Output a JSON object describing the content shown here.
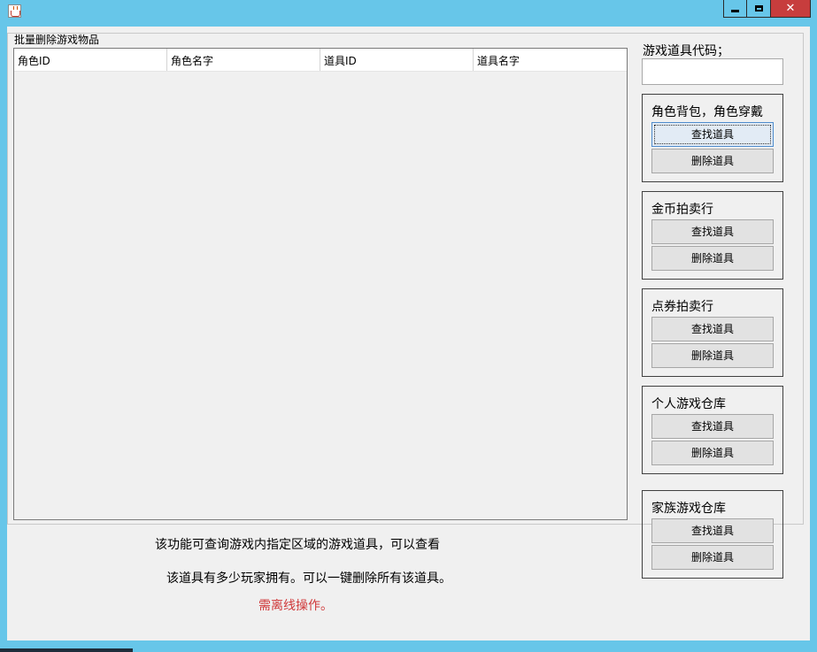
{
  "window": {
    "app_icon": "java-coffee-icon",
    "controls": {
      "minimize": "minimize-icon",
      "maximize": "maximize-icon",
      "close": "close-icon",
      "close_glyph": "✕"
    },
    "colors": {
      "frame": "#67c6e9",
      "close": "#c73d3d",
      "client": "#f0f0f0",
      "warning": "#d0393a"
    }
  },
  "main": {
    "group_title": "批量删除游戏物品",
    "table": {
      "columns": [
        "角色ID",
        "角色名字",
        "道具ID",
        "道具名字"
      ],
      "rows": []
    }
  },
  "side": {
    "code_label": "游戏道具代码；",
    "code_value": "",
    "groups": [
      {
        "title": "角色背包，角色穿戴",
        "find_label": "查找道具",
        "delete_label": "删除道具"
      },
      {
        "title": "金币拍卖行",
        "find_label": "查找道具",
        "delete_label": "删除道具"
      },
      {
        "title": "点券拍卖行",
        "find_label": "查找道具",
        "delete_label": "删除道具"
      },
      {
        "title": "个人游戏仓库",
        "find_label": "查找道具",
        "delete_label": "删除道具"
      },
      {
        "title": "家族游戏仓库",
        "find_label": "查找道具",
        "delete_label": "删除道具"
      }
    ]
  },
  "description": {
    "line1": "该功能可查询游戏内指定区域的游戏道具，可以查看",
    "line2": "该道具有多少玩家拥有。可以一键删除所有该道具。",
    "warning": "需离线操作。"
  }
}
